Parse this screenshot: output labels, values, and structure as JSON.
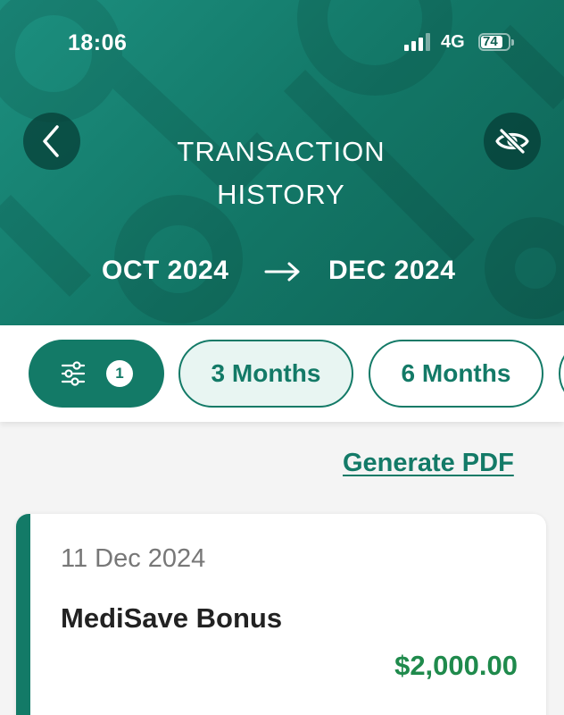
{
  "status_bar": {
    "time": "18:06",
    "network": "4G",
    "battery_level": "74",
    "signal_bars_active": 3,
    "signal_bars_total": 4
  },
  "header": {
    "back_icon": "chevron-left-icon",
    "title_line1": "TRANSACTION",
    "title_line2": "HISTORY",
    "hide_icon": "eye-off-icon",
    "range_start": "OCT 2024",
    "range_end": "DEC 2024",
    "range_arrow_icon": "arrow-right-icon"
  },
  "filters": {
    "filter_icon": "sliders-icon",
    "filter_count": "1",
    "periods": [
      {
        "label": "3 Months",
        "selected": true
      },
      {
        "label": "6 Months",
        "selected": false
      }
    ]
  },
  "actions": {
    "generate_pdf": "Generate PDF"
  },
  "transactions": [
    {
      "date": "11 Dec 2024",
      "title": "MediSave Bonus",
      "amount": "$2,000.00"
    }
  ],
  "colors": {
    "brand_green": "#137a67",
    "amount_green": "#1f8a4c",
    "header_gradient_start": "#1c8f7f",
    "header_gradient_end": "#0f6457"
  }
}
